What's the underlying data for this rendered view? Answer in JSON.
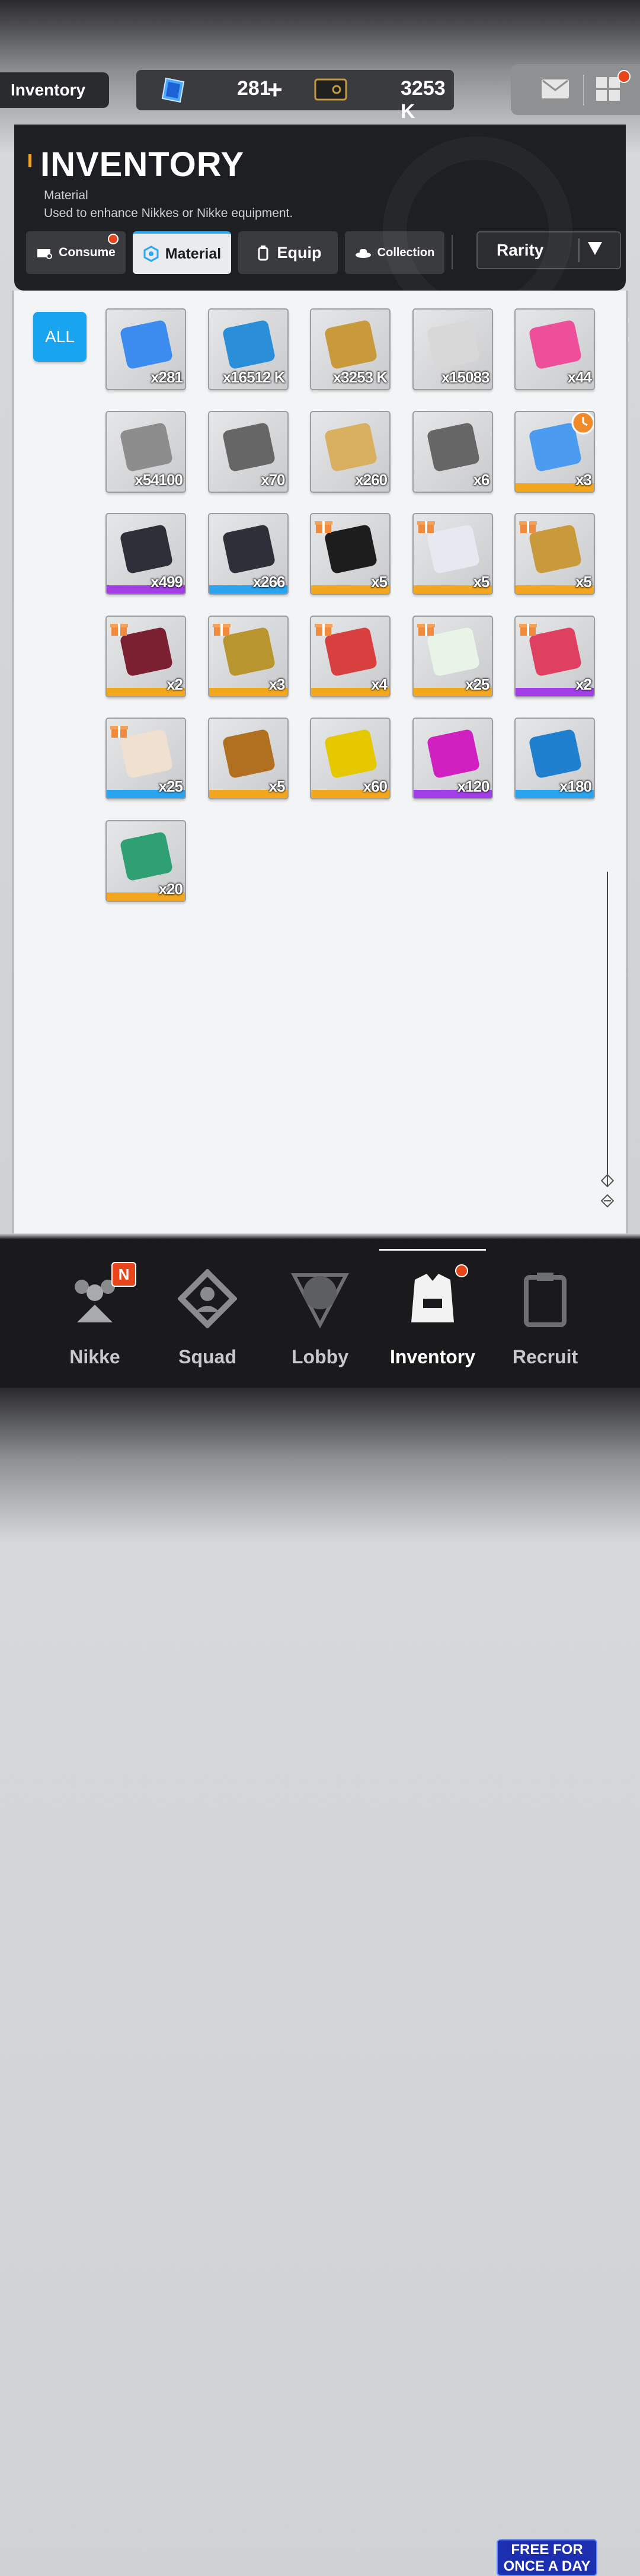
{
  "header": {
    "location_label": "Inventory",
    "gems": "281",
    "credits": "3253 K"
  },
  "panel": {
    "title": "INVENTORY",
    "subtitle": "Material",
    "description": "Used to enhance Nikkes or Nikke equipment.",
    "tabs": [
      {
        "label": "Consume"
      },
      {
        "label": "Material"
      },
      {
        "label": "Equip"
      },
      {
        "label": "Collection"
      }
    ],
    "sort_label": "Rarity"
  },
  "filter": {
    "all_label": "ALL"
  },
  "items": [
    {
      "name": "body-label-crystal",
      "count": "x281",
      "rarity": "none",
      "gift": false
    },
    {
      "name": "battle-data-drive",
      "count": "x16512 K",
      "rarity": "none",
      "gift": false
    },
    {
      "name": "credit-card",
      "count": "x3253 K",
      "rarity": "none",
      "gift": false
    },
    {
      "name": "core-dust-orb",
      "count": "x15083",
      "rarity": "none",
      "gift": false
    },
    {
      "name": "gem-heart",
      "count": "x44",
      "rarity": "none",
      "gift": false
    },
    {
      "name": "dna-code",
      "count": "x54100",
      "rarity": "none",
      "gift": false
    },
    {
      "name": "silver-wing-card",
      "count": "x70",
      "rarity": "none",
      "gift": false
    },
    {
      "name": "gold-wing-card",
      "count": "x260",
      "rarity": "none",
      "gift": false
    },
    {
      "name": "infinity-module",
      "count": "x6",
      "rarity": "none",
      "gift": false
    },
    {
      "name": "event-ticket",
      "count": "x3",
      "rarity": "SSR",
      "gift": false,
      "timer": true
    },
    {
      "name": "dark-case-purple",
      "count": "x499",
      "rarity": "SR",
      "gift": false
    },
    {
      "name": "dark-case-blue",
      "count": "x266",
      "rarity": "R",
      "gift": false
    },
    {
      "name": "graduation-cap",
      "count": "x5",
      "rarity": "SSR",
      "gift": true
    },
    {
      "name": "teacup",
      "count": "x5",
      "rarity": "SSR",
      "gift": true
    },
    {
      "name": "police-badge",
      "count": "x5",
      "rarity": "SSR",
      "gift": true
    },
    {
      "name": "vip-beauty-card",
      "count": "x2",
      "rarity": "SSR",
      "gift": true
    },
    {
      "name": "vip-gold-card",
      "count": "x3",
      "rarity": "SSR",
      "gift": true
    },
    {
      "name": "red-id-card",
      "count": "x4",
      "rarity": "SSR",
      "gift": true
    },
    {
      "name": "birthday-ticket",
      "count": "x25",
      "rarity": "SSR",
      "gift": true
    },
    {
      "name": "date-ticket",
      "count": "x2",
      "rarity": "SR",
      "gift": true
    },
    {
      "name": "voucher-ticket",
      "count": "x25",
      "rarity": "R",
      "gift": true
    },
    {
      "name": "film-roll",
      "count": "x5",
      "rarity": "SSR",
      "gift": false
    },
    {
      "name": "yellow-tablet",
      "count": "x60",
      "rarity": "SSR",
      "gift": false
    },
    {
      "name": "purple-tablet",
      "count": "x120",
      "rarity": "SR",
      "gift": false
    },
    {
      "name": "blue-tablet",
      "count": "x180",
      "rarity": "R",
      "gift": false
    },
    {
      "name": "green-capsule",
      "count": "x20",
      "rarity": "SSR",
      "gift": false
    }
  ],
  "rarity_colors": {
    "SSR": "#f2a71e",
    "SR": "#a33ee6",
    "R": "#2aa4ef",
    "none": "transparent"
  },
  "nav": [
    {
      "label": "Nikke",
      "badge": "N"
    },
    {
      "label": "Squad"
    },
    {
      "label": "Lobby"
    },
    {
      "label": "Inventory"
    },
    {
      "label": "Recruit"
    }
  ],
  "promo": {
    "line1": "FREE FOR",
    "line2": "ONCE A DAY"
  }
}
